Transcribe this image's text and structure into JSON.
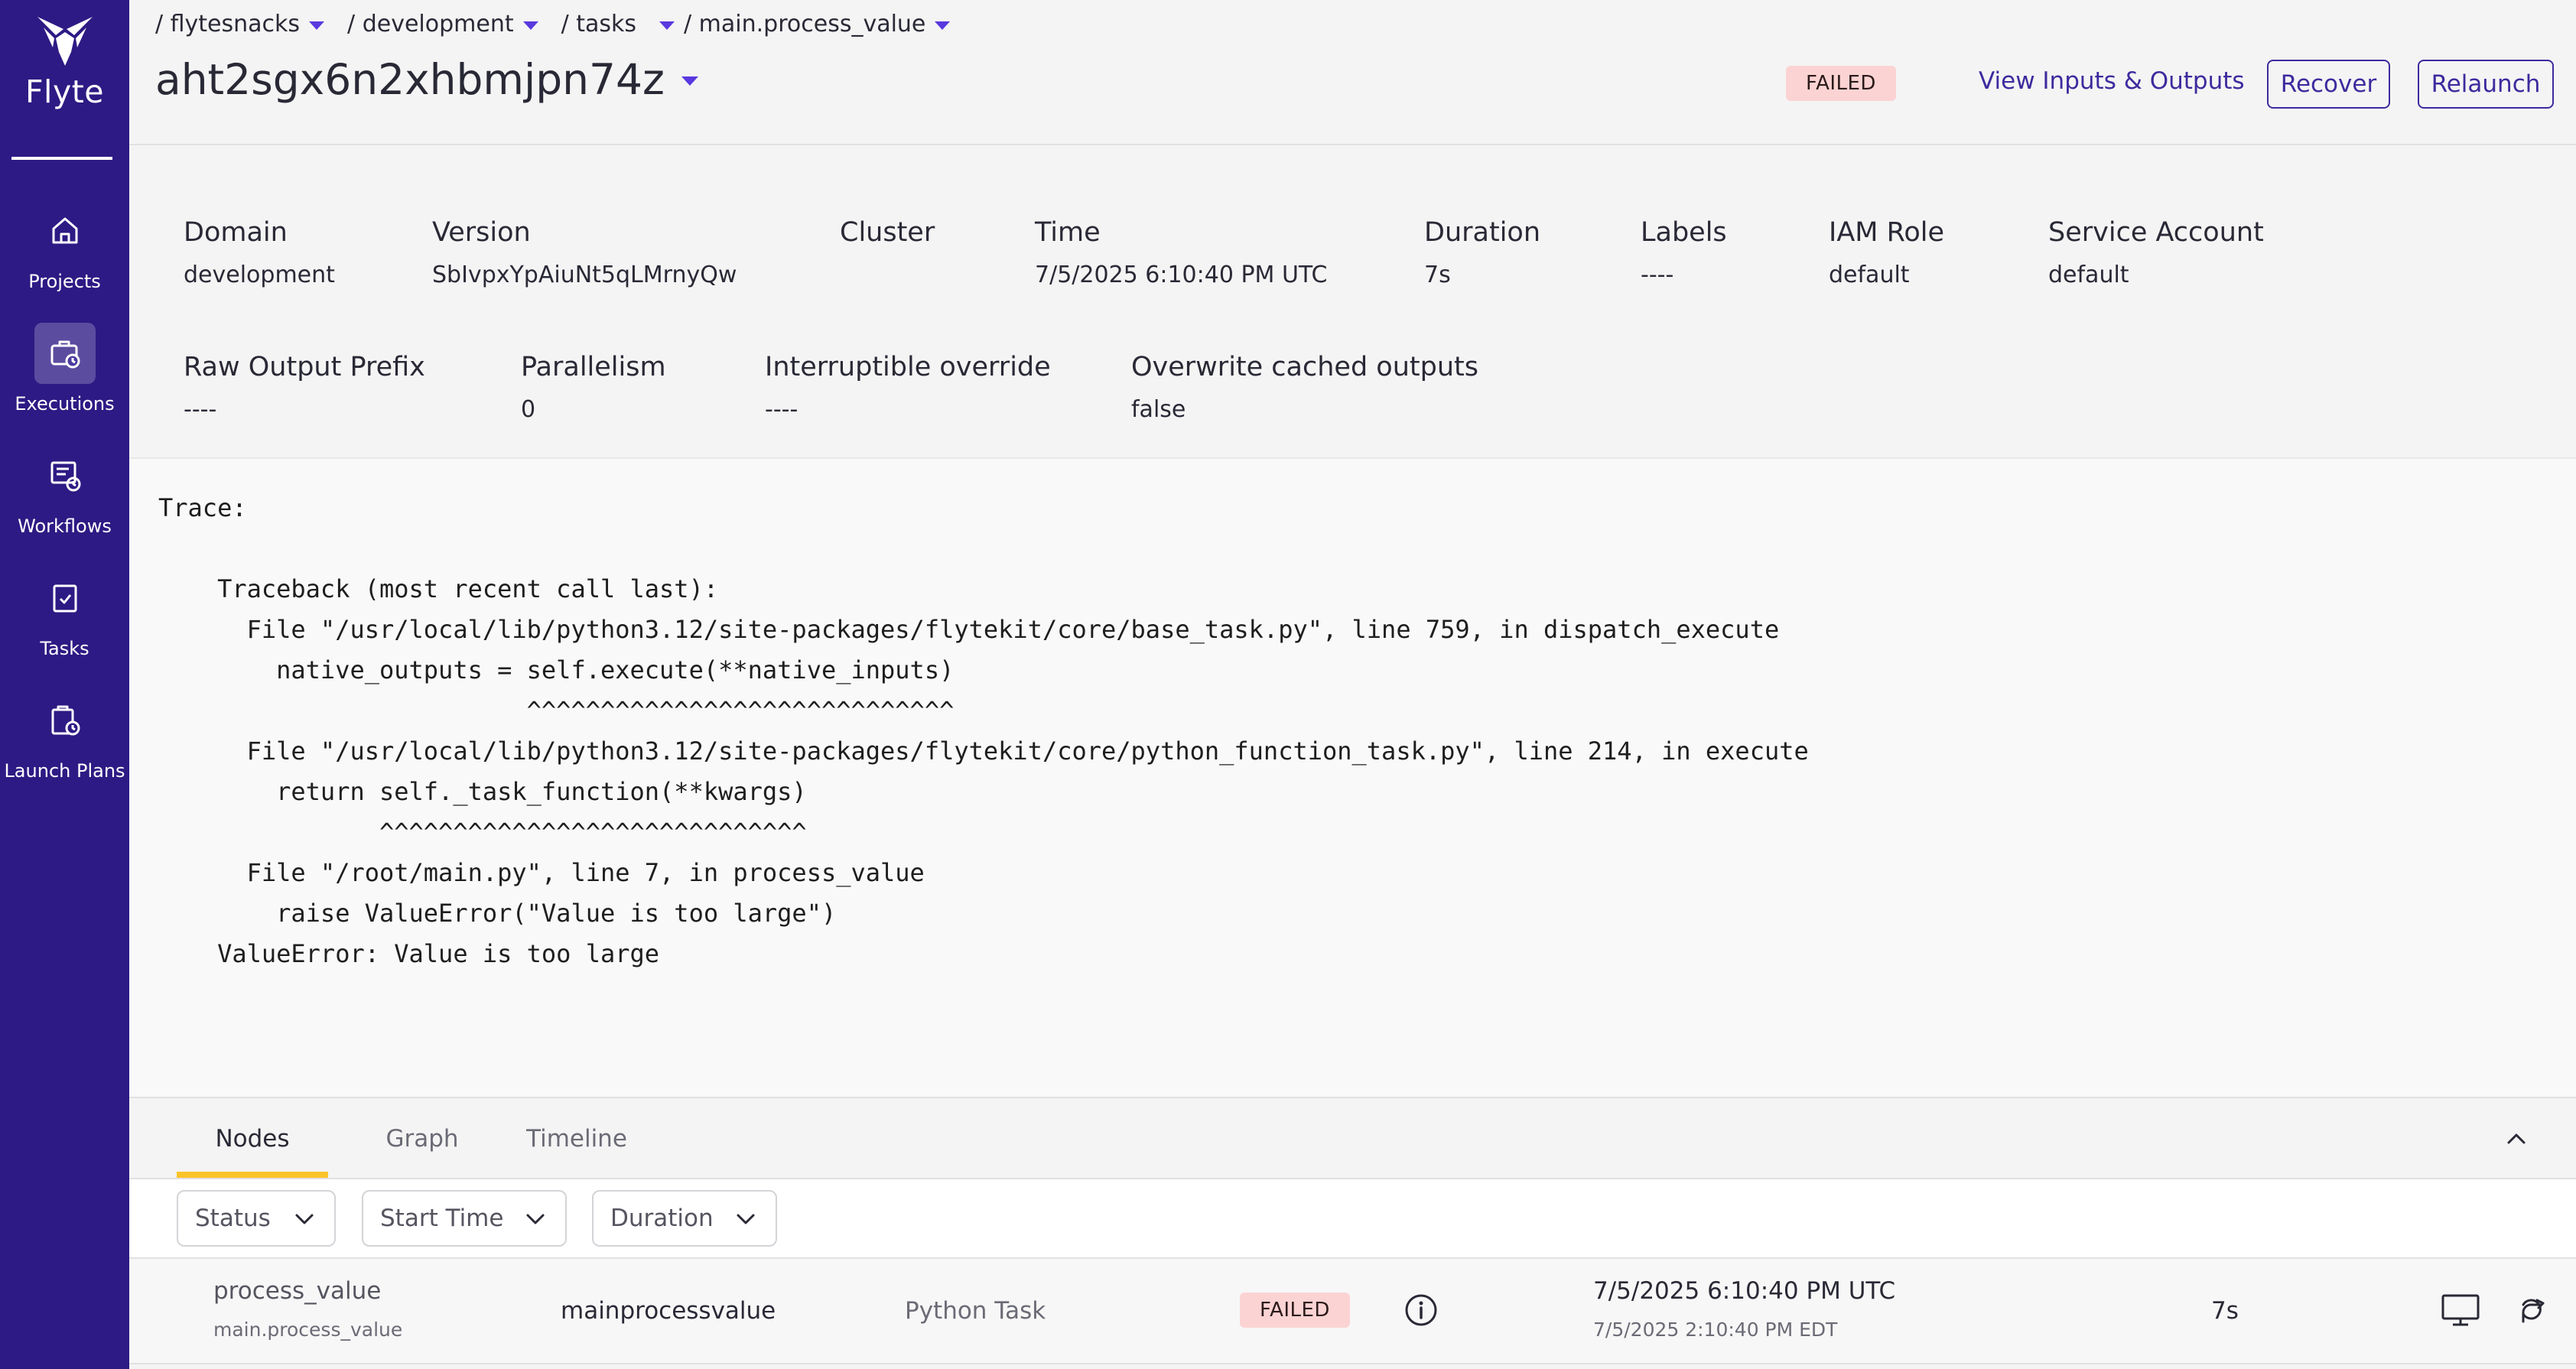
{
  "sidebar": {
    "brand": "Flyte",
    "items": [
      {
        "label": "Projects",
        "icon": "home-icon"
      },
      {
        "label": "Executions",
        "icon": "executions-icon"
      },
      {
        "label": "Workflows",
        "icon": "workflows-icon"
      },
      {
        "label": "Tasks",
        "icon": "tasks-icon"
      },
      {
        "label": "Launch Plans",
        "icon": "launch-plans-icon"
      }
    ],
    "active": "Executions"
  },
  "header": {
    "breadcrumb": [
      "/ flytesnacks",
      "/ development",
      "/ tasks",
      "/ main.process_value"
    ],
    "title": "aht2sgx6n2xhbmjpn74z",
    "status": "FAILED",
    "view_io": "View Inputs & Outputs",
    "recover": "Recover",
    "relaunch": "Relaunch"
  },
  "meta": {
    "row1": [
      {
        "label": "Domain",
        "value": "development"
      },
      {
        "label": "Version",
        "value": "SbIvpxYpAiuNt5qLMrnyQw"
      },
      {
        "label": "Cluster",
        "value": ""
      },
      {
        "label": "Time",
        "value": "7/5/2025 6:10:40 PM UTC"
      },
      {
        "label": "Duration",
        "value": "7s"
      },
      {
        "label": "Labels",
        "value": "----"
      },
      {
        "label": "IAM Role",
        "value": "default"
      },
      {
        "label": "Service Account",
        "value": "default"
      }
    ],
    "row2": [
      {
        "label": "Raw Output Prefix",
        "value": "----"
      },
      {
        "label": "Parallelism",
        "value": "0"
      },
      {
        "label": "Interruptible override",
        "value": "----"
      },
      {
        "label": "Overwrite cached outputs",
        "value": "false"
      }
    ]
  },
  "trace": {
    "text": "Trace:\n\n    Traceback (most recent call last):\n      File \"/usr/local/lib/python3.12/site-packages/flytekit/core/base_task.py\", line 759, in dispatch_execute\n        native_outputs = self.execute(**native_inputs)\n                         ^^^^^^^^^^^^^^^^^^^^^^^^^^^^^\n      File \"/usr/local/lib/python3.12/site-packages/flytekit/core/python_function_task.py\", line 214, in execute\n        return self._task_function(**kwargs)\n               ^^^^^^^^^^^^^^^^^^^^^^^^^^^^^\n      File \"/root/main.py\", line 7, in process_value\n        raise ValueError(\"Value is too large\")\n    ValueError: Value is too large"
  },
  "tabs": [
    {
      "label": "Nodes",
      "active": true
    },
    {
      "label": "Graph",
      "active": false
    },
    {
      "label": "Timeline",
      "active": false
    }
  ],
  "filters": [
    "Status",
    "Start Time",
    "Duration"
  ],
  "nodes": [
    {
      "name": "process_value",
      "sub": "main.process_value",
      "node_id": "mainprocessvalue",
      "type": "Python Task",
      "status": "FAILED",
      "start_utc": "7/5/2025 6:10:40 PM UTC",
      "start_local": "7/5/2025 2:10:40 PM EDT",
      "duration": "7s"
    }
  ],
  "colors": {
    "sidebar": "#2e1a84",
    "accent": "#5a39e0",
    "link": "#3e2a9e",
    "failed_bg": "#fcd3d3",
    "tab_underline": "#fcc32a"
  }
}
